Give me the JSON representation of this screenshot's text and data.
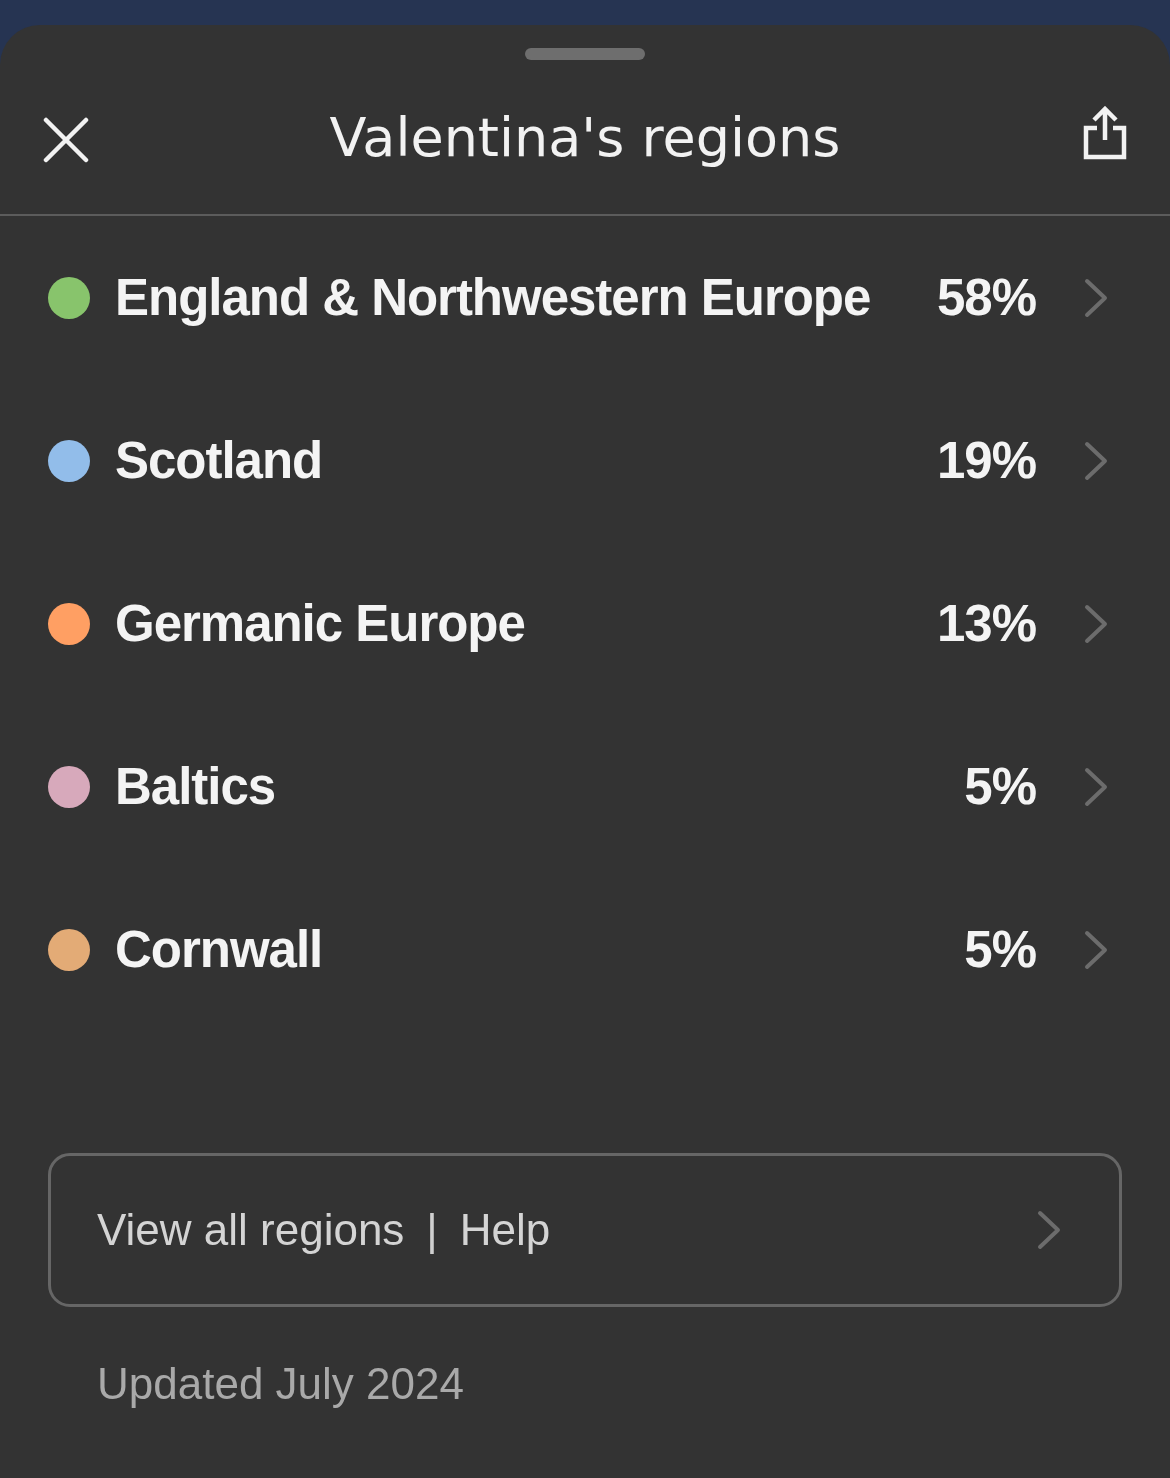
{
  "sheet": {
    "title": "Valentina's regions"
  },
  "regions": [
    {
      "name": "England & Northwestern Europe",
      "percent": "58%",
      "color": "#88c46c"
    },
    {
      "name": "Scotland",
      "percent": "19%",
      "color": "#92bdea"
    },
    {
      "name": "Germanic Europe",
      "percent": "13%",
      "color": "#ff9f63"
    },
    {
      "name": "Baltics",
      "percent": "5%",
      "color": "#d7a9bb"
    },
    {
      "name": "Cornwall",
      "percent": "5%",
      "color": "#e3ab76"
    }
  ],
  "footer": {
    "links": [
      "View all regions",
      "Help"
    ],
    "separator": "|",
    "updated": "Updated July 2024"
  }
}
